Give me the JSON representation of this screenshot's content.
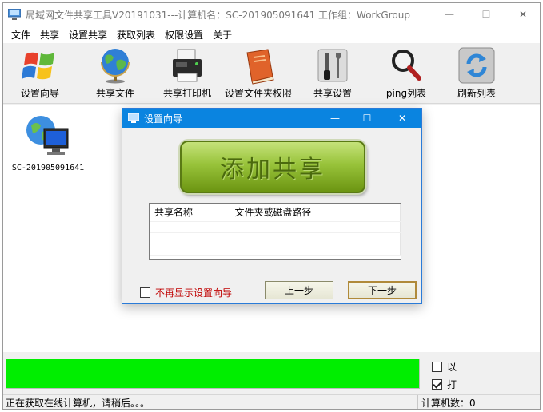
{
  "window": {
    "title": "局域网文件共享工具V20191031---计算机名：SC-201905091641  工作组：WorkGroup",
    "minimize_glyph": "—",
    "maximize_glyph": "☐",
    "close_glyph": "✕"
  },
  "menu": [
    "文件",
    "共享",
    "设置共享",
    "获取列表",
    "权限设置",
    "关于"
  ],
  "toolbar": [
    {
      "label": "设置向导",
      "icon": "windows-flag-icon"
    },
    {
      "label": "共享文件",
      "icon": "globe-icon"
    },
    {
      "label": "共享打印机",
      "icon": "printer-icon"
    },
    {
      "label": "设置文件夹权限",
      "icon": "book-icon"
    },
    {
      "label": "共享设置",
      "icon": "tools-icon"
    },
    {
      "label": "ping列表",
      "icon": "magnifier-icon"
    },
    {
      "label": "刷新列表",
      "icon": "refresh-icon"
    }
  ],
  "computers": [
    {
      "label": "SC-201905091641",
      "icon": "network-computer-icon"
    }
  ],
  "progress": {
    "fraction": 1.0,
    "color": "#00ee00"
  },
  "options": [
    {
      "label": "以",
      "checked": false
    },
    {
      "label": "打",
      "checked": true
    }
  ],
  "status": {
    "left": "正在获取在线计算机，请稍后。。。",
    "right": "计算机数：0"
  },
  "dialog": {
    "title": "设置向导",
    "minimize_glyph": "—",
    "maximize_glyph": "☐",
    "close_glyph": "✕",
    "add_share_label": "添加共享",
    "table_headers": [
      "共享名称",
      "文件夹或磁盘路径"
    ],
    "no_show_label": "不再显示设置向导",
    "no_show_checked": false,
    "prev_label": "上一步",
    "next_label": "下一步"
  },
  "colors": {
    "title_active": "#0a84e0",
    "progress": "#00ee00",
    "warning_text": "#c00000"
  }
}
